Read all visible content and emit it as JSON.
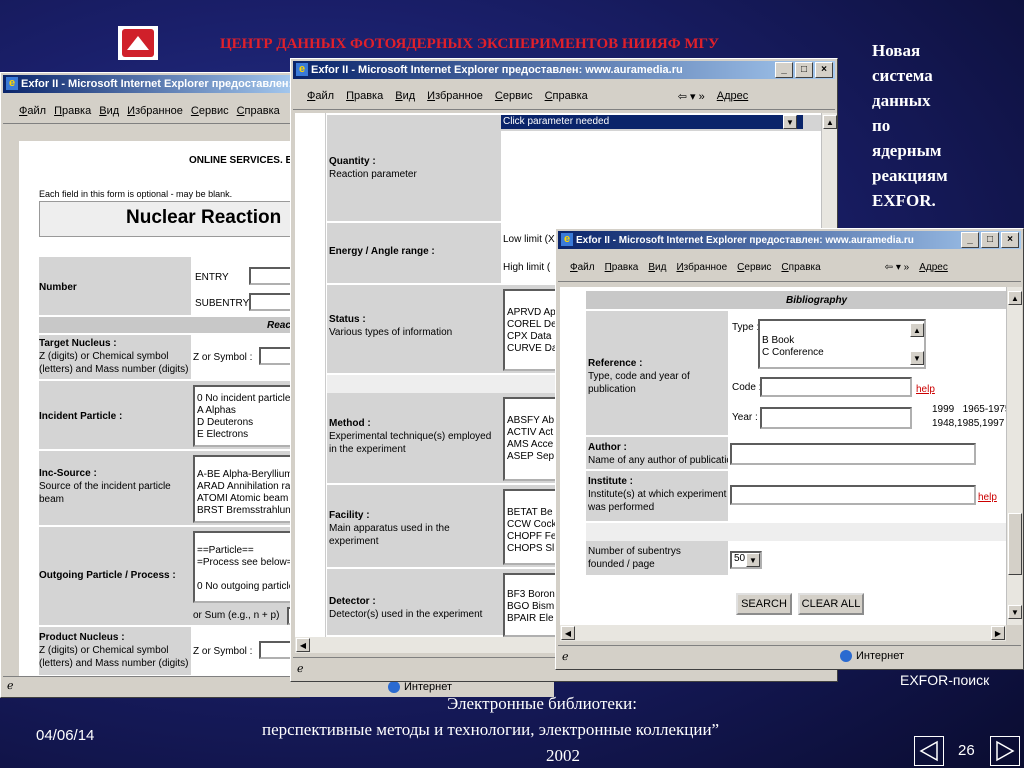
{
  "slide": {
    "header": "ЦЕНТР ДАННЫХ ФОТОЯДЕРНЫХ ЭКСПЕРИМЕНТОВ НИИЯФ МГУ",
    "side_title_lines": [
      "Новая",
      "система",
      "данных",
      "по",
      "ядерным",
      "реакциям",
      "EXFOR."
    ],
    "caption": "EXFOR-поиск",
    "footer_line1": "Электронные библиотеки:",
    "footer_line2": "перспективные методы и технологии, электронные коллекции”",
    "footer_year": "2002",
    "date": "04/06/14",
    "page_number": "26"
  },
  "window_back": {
    "title": "Exfor II - Microsoft Internet Explorer предоставлен: w",
    "menu": [
      "Файл",
      "Правка",
      "Вид",
      "Избранное",
      "Сервис",
      "Справка"
    ],
    "online_services": "ONLINE SERVICES. EX",
    "optional_note": "Each field in this form is optional - may be blank.",
    "heading": "Nuclear Reaction",
    "number_label": "Number",
    "entry_label": "ENTRY",
    "subentry_label": "SUBENTRY",
    "reac_label": "Reac",
    "target_title": "Target Nucleus :",
    "target_desc": "Z (digits) or Chemical symbol (letters) and Mass number (digits)",
    "z_or_symbol": "Z or Symbol :",
    "incident_title": "Incident Particle :",
    "incident_list": [
      "0 No incident particle -",
      "A Alphas",
      "D Deuterons",
      "E Electrons"
    ],
    "incsource_title": "Inc-Source :",
    "incsource_desc": "Source of the incident particle beam",
    "incsource_list": [
      "A-BE Alpha-Beryllium",
      "ARAD Annihilation rad",
      "ATOMI Atomic beam",
      "BRST Bremsstrahlung"
    ],
    "outgoing_title": "Outgoing Particle / Process :",
    "outgoing_list": [
      "==Particle==",
      "=Process see below=",
      "",
      "0 No outgoing particle"
    ],
    "or_sum": "or Sum (e.g., n + p)",
    "product_title": "Product Nucleus :",
    "product_desc": "Z (digits) or Chemical symbol (letters) and Mass number (digits)",
    "status_text": "Интернет"
  },
  "window_mid": {
    "title": "Exfor II - Microsoft Internet Explorer предоставлен: www.auramedia.ru",
    "menu": [
      "Файл",
      "Правка",
      "Вид",
      "Избранное",
      "Сервис",
      "Справка"
    ],
    "address_label": "Адрес",
    "quantity_select": "Click parameter needed",
    "quantity_title": "Quantity :",
    "quantity_desc": "Reaction parameter",
    "energy_title": "Energy / Angle range :",
    "low_limit": "Low limit (X",
    "high_limit": "High limit (",
    "status_title": "Status :",
    "status_desc": "Various types of information",
    "status_list": [
      "APRVD Ap",
      "COREL De",
      "CPX Data",
      "CURVE Da"
    ],
    "method_title": "Method :",
    "method_desc": "Experimental technique(s) employed in the experiment",
    "method_list": [
      "ABSFY Ab",
      "ACTIV Act",
      "AMS Acce",
      "ASEP Sep"
    ],
    "facility_title": "Facility :",
    "facility_desc": "Main apparatus used in the experiment",
    "facility_list": [
      "BETAT Be",
      "CCW Cock",
      "CHOPF Fe",
      "CHOPS Sl"
    ],
    "detector_title": "Detector :",
    "detector_desc": "Detector(s) used in the experiment",
    "detector_list": [
      "BF3 Boron",
      "BGO Bism",
      "BPAIR Ele",
      ""
    ],
    "status_text": "Интернет"
  },
  "window_front": {
    "title": "Exfor II - Microsoft Internet Explorer предоставлен: www.auramedia.ru",
    "menu": [
      "Файл",
      "Правка",
      "Вид",
      "Избранное",
      "Сервис",
      "Справка"
    ],
    "address_label": "Адрес",
    "section": "Bibliography",
    "reference_title": "Reference :",
    "reference_desc": "Type, code and year of publication",
    "type_label": "Type :",
    "type_options": [
      "B Book",
      "C Conference"
    ],
    "code_label": "Code :",
    "help_link": "help",
    "year_label": "Year :",
    "year_hint1": "1999   1965-1975",
    "year_hint2": "1948,1985,1997",
    "author_title": "Author :",
    "author_desc": "Name of any author of publication",
    "institute_title": "Institute :",
    "institute_desc": "Institute(s) at which experiment was performed",
    "subentrys_label1": "Number of subentrys",
    "subentrys_label2": "founded / page",
    "page_count": "50",
    "search_button": "SEARCH",
    "clear_button": "CLEAR ALL",
    "status_text": "Интернет"
  },
  "colors": {
    "header_red": "#e0202a",
    "titlebar": "#0a246a",
    "help_link": "#cc0000"
  }
}
